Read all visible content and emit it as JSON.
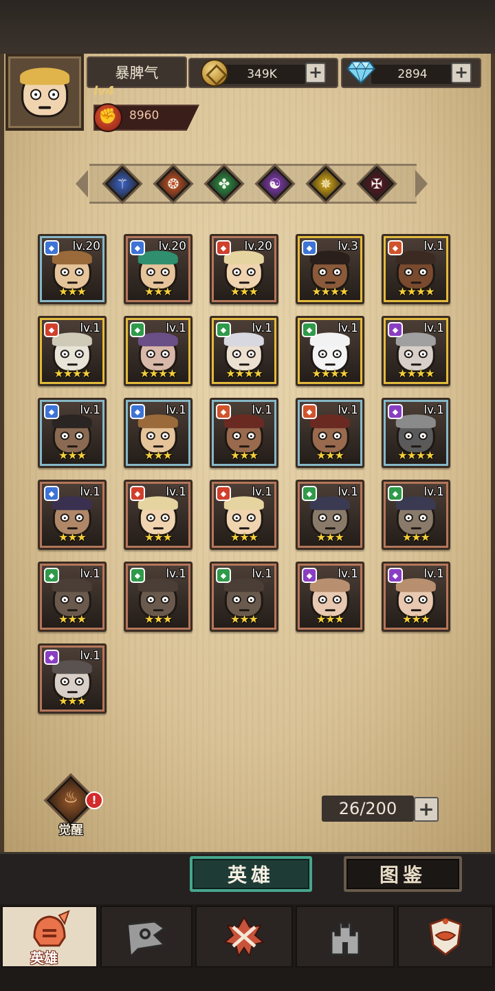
{
  "header": {
    "player_name": "暴脾气",
    "level": "lv4",
    "power": "8960",
    "coins": "349K",
    "gems": "2894"
  },
  "element_filters": [
    {
      "name": "blue",
      "color": "#3b63c4",
      "glyph": "⚚"
    },
    {
      "name": "orange",
      "color": "#d2592a",
      "glyph": "❂"
    },
    {
      "name": "green",
      "color": "#2f9a4a",
      "glyph": "✤"
    },
    {
      "name": "purple",
      "color": "#8a3fc2",
      "glyph": "☯"
    },
    {
      "name": "yellow",
      "color": "#e2b318",
      "glyph": "✵"
    },
    {
      "name": "dark-red",
      "color": "#5a1a26",
      "glyph": "✠"
    }
  ],
  "heroes": [
    {
      "level": "lv.20",
      "stars": 3,
      "class_color": "#3d74d6",
      "frame": "blue",
      "hair": "#9b6a3a",
      "skin": "#e6c49a"
    },
    {
      "level": "lv.20",
      "stars": 3,
      "class_color": "#3d74d6",
      "frame": "bronze",
      "hair": "#2f8f6e",
      "skin": "#e6c49a"
    },
    {
      "level": "lv.20",
      "stars": 3,
      "class_color": "#d0402c",
      "frame": "bronze",
      "hair": "#e6d4a0",
      "skin": "#f0d4b0"
    },
    {
      "level": "lv.3",
      "stars": 4,
      "class_color": "#3d74d6",
      "frame": "gold",
      "hair": "#2a1f1a",
      "skin": "#8a5a3a"
    },
    {
      "level": "lv.1",
      "stars": 4,
      "class_color": "#d0532c",
      "frame": "gold",
      "hair": "#3a2a22",
      "skin": "#7a4a2e"
    },
    {
      "level": "lv.1",
      "stars": 4,
      "class_color": "#d0402c",
      "frame": "gold",
      "hair": "#cfcab8",
      "skin": "#e8e4d8"
    },
    {
      "level": "lv.1",
      "stars": 4,
      "class_color": "#2f9a4a",
      "frame": "gold",
      "hair": "#6a4e86",
      "skin": "#d8b8a8"
    },
    {
      "level": "lv.1",
      "stars": 4,
      "class_color": "#2f9a4a",
      "frame": "gold",
      "hair": "#d8d8e0",
      "skin": "#ece0d0"
    },
    {
      "level": "lv.1",
      "stars": 4,
      "class_color": "#2f9a4a",
      "frame": "gold",
      "hair": "#f2f2f2",
      "skin": "#f4f4f4"
    },
    {
      "level": "lv.1",
      "stars": 4,
      "class_color": "#8a3fc2",
      "frame": "gold",
      "hair": "#a0a0a0",
      "skin": "#d8d0c8"
    },
    {
      "level": "lv.1",
      "stars": 3,
      "class_color": "#3d74d6",
      "frame": "blue",
      "hair": "#2a2422",
      "skin": "#8a6a52"
    },
    {
      "level": "lv.1",
      "stars": 3,
      "class_color": "#3d74d6",
      "frame": "blue",
      "hair": "#9b6a3a",
      "skin": "#e6c49a"
    },
    {
      "level": "lv.1",
      "stars": 3,
      "class_color": "#d0532c",
      "frame": "blue",
      "hair": "#6a2a22",
      "skin": "#9a6a4e"
    },
    {
      "level": "lv.1",
      "stars": 3,
      "class_color": "#d0532c",
      "frame": "blue",
      "hair": "#6a2a22",
      "skin": "#9a6a4e"
    },
    {
      "level": "lv.1",
      "stars": 4,
      "class_color": "#8a3fc2",
      "frame": "blue",
      "hair": "#8a8a8a",
      "skin": "#5a5a5a"
    },
    {
      "level": "lv.1",
      "stars": 3,
      "class_color": "#3d74d6",
      "frame": "bronze",
      "hair": "#3a3050",
      "skin": "#b08868"
    },
    {
      "level": "lv.1",
      "stars": 3,
      "class_color": "#d0402c",
      "frame": "bronze",
      "hair": "#e6d4a0",
      "skin": "#f0d4b0"
    },
    {
      "level": "lv.1",
      "stars": 3,
      "class_color": "#d0402c",
      "frame": "bronze",
      "hair": "#e6d4a0",
      "skin": "#f0d4b0"
    },
    {
      "level": "lv.1",
      "stars": 3,
      "class_color": "#2f9a4a",
      "frame": "bronze",
      "hair": "#3a3a52",
      "skin": "#8a7a6a"
    },
    {
      "level": "lv.1",
      "stars": 3,
      "class_color": "#2f9a4a",
      "frame": "bronze",
      "hair": "#3a3a52",
      "skin": "#8a7a6a"
    },
    {
      "level": "lv.1",
      "stars": 3,
      "class_color": "#2f9a4a",
      "frame": "bronze",
      "hair": "#4a3e36",
      "skin": "#6a5a4e"
    },
    {
      "level": "lv.1",
      "stars": 3,
      "class_color": "#2f9a4a",
      "frame": "bronze",
      "hair": "#4a3e36",
      "skin": "#6a5a4e"
    },
    {
      "level": "lv.1",
      "stars": 3,
      "class_color": "#2f9a4a",
      "frame": "bronze",
      "hair": "#4a3e36",
      "skin": "#6a5a4e"
    },
    {
      "level": "lv.1",
      "stars": 3,
      "class_color": "#8a3fc2",
      "frame": "bronze",
      "hair": "#b89070",
      "skin": "#e8c8b0"
    },
    {
      "level": "lv.1",
      "stars": 3,
      "class_color": "#8a3fc2",
      "frame": "bronze",
      "hair": "#b89070",
      "skin": "#e8c8b0"
    },
    {
      "level": "lv.1",
      "stars": 3,
      "class_color": "#8a3fc2",
      "frame": "bronze",
      "hair": "#5a5250",
      "skin": "#d8d0c8"
    }
  ],
  "awaken": {
    "label": "觉醒",
    "alert": "!"
  },
  "capacity": "26/200",
  "subtabs": {
    "heroes": "英雄",
    "codex": "图鉴"
  },
  "bottom_nav": {
    "active_label": "英雄",
    "items": [
      "helmet-icon",
      "flag-icon",
      "crossed-swords-icon",
      "castle-icon",
      "guild-emblem-icon"
    ]
  },
  "colors": {
    "frame_blue": "#86b8c8",
    "frame_bronze": "#b5765a",
    "frame_gold": "#e3bb3c",
    "accent_teal": "#46a68e"
  }
}
